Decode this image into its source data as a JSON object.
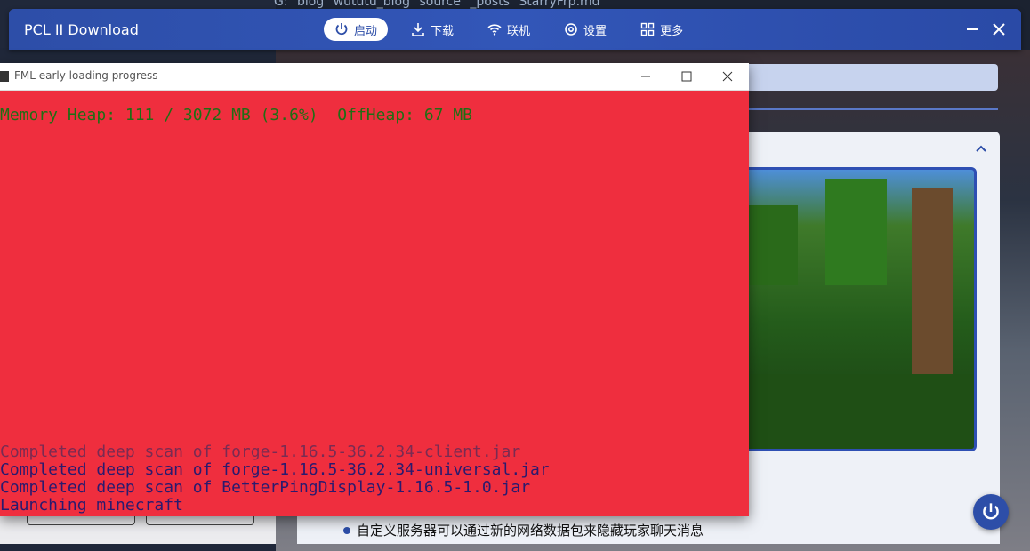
{
  "breadcrumb": [
    "G:",
    "blog",
    "wututu_blog",
    "source",
    "_posts",
    "StarryFrp.md"
  ],
  "app": {
    "title": "PCL II Download",
    "nav": [
      {
        "label": "启动",
        "icon": "power-icon",
        "active": true
      },
      {
        "label": "下载",
        "icon": "download-icon",
        "active": false
      },
      {
        "label": "联机",
        "icon": "wifi-icon",
        "active": false
      },
      {
        "label": "设置",
        "icon": "gear-icon",
        "active": false
      },
      {
        "label": "更多",
        "icon": "grid-icon",
        "active": false
      }
    ],
    "accent": "#2d4ea8"
  },
  "content": {
    "bullet": "自定义服务器可以通过新的网络数据包来隐藏玩家聊天消息"
  },
  "fml": {
    "title": "FML early loading progress",
    "background": "#ef2e3e",
    "memory_line": "Memory Heap: 111 / 3072 MB (3.6%)  OffHeap: 67 MB",
    "log": [
      "Completed deep scan of forge-1.16.5-36.2.34-client.jar",
      "Completed deep scan of forge-1.16.5-36.2.34-universal.jar",
      "Completed deep scan of BetterPingDisplay-1.16.5-1.0.jar",
      "Launching minecraft"
    ]
  }
}
